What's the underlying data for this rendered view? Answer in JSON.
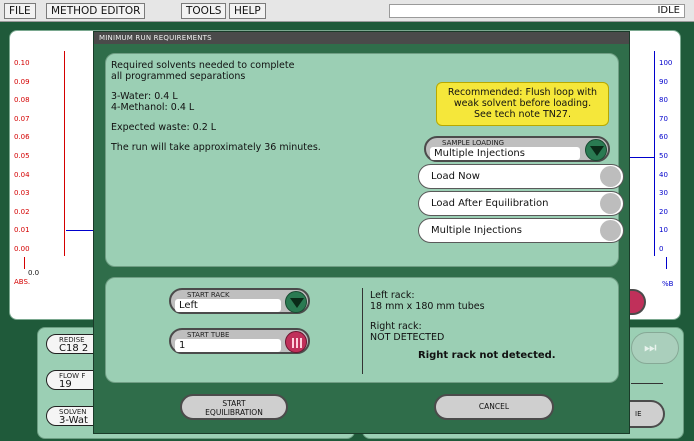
{
  "menu": {
    "file": "FILE",
    "method_editor": "METHOD EDITOR",
    "tools": "TOOLS",
    "help": "HELP",
    "status": "IDLE"
  },
  "background": {
    "left_ticks": [
      "0.10",
      "0.09",
      "0.08",
      "0.07",
      "0.06",
      "0.05",
      "0.04",
      "0.03",
      "0.02",
      "0.01",
      "0.00"
    ],
    "left_axis_zero": "0.0",
    "left_axis_unit": "ABS.",
    "right_ticks": [
      "100",
      "90",
      "80",
      "70",
      "60",
      "50",
      "40",
      "30",
      "20",
      "10",
      "0"
    ],
    "right_axis_unit": "%B",
    "column_label": "REDISE",
    "column_value": "C18 2",
    "flow_label": "FLOW F",
    "flow_value": "19",
    "solvent_label": "SOLVEN",
    "solvent_value": "3-Wat",
    "right_button_fragment": "IE"
  },
  "dialog": {
    "title": "MINIMUM RUN REQUIREMENTS",
    "intro_line1": "Required solvents needed to complete",
    "intro_line2": "all programmed separations",
    "water": "3-Water: 0.4 L",
    "methanol": "4-Methanol: 0.4 L",
    "waste": "Expected waste: 0.2 L",
    "duration": "The run will take approximately 36 minutes.",
    "note_line1": "Recommended: Flush loop with",
    "note_line2": "weak solvent before loading.",
    "note_line3": "See tech note TN27.",
    "sample_loading_label": "SAMPLE LOADING",
    "sample_loading_value": "Multiple Injections",
    "options": [
      "Load Now",
      "Load After Equilibration",
      "Multiple Injections"
    ],
    "start_rack_label": "START RACK",
    "start_rack_value": "Left",
    "start_tube_label": "START TUBE",
    "start_tube_value": "1",
    "left_rack_label": "Left rack:",
    "left_rack_value": "18 mm x 180 mm tubes",
    "right_rack_label": "Right rack:",
    "right_rack_value": "NOT DETECTED",
    "warning": "Right rack not detected.",
    "start_button_line1": "START",
    "start_button_line2": "EQUILIBRATION",
    "cancel_button": "CANCEL"
  },
  "colors": {
    "background": "#1f5a3a",
    "panel": "#9bcfb4",
    "dialog": "#2f6d4a",
    "note": "#f5e73a",
    "dropdown_arrow": "#2a7a52",
    "grid_button": "#c0305a",
    "left_axis": "#d40000",
    "right_axis": "#0000cc"
  },
  "icons": {
    "dropdown_arrow": "chevron-down-icon",
    "grid_select": "grid-icon",
    "fast_forward": "fast-forward-icon"
  }
}
